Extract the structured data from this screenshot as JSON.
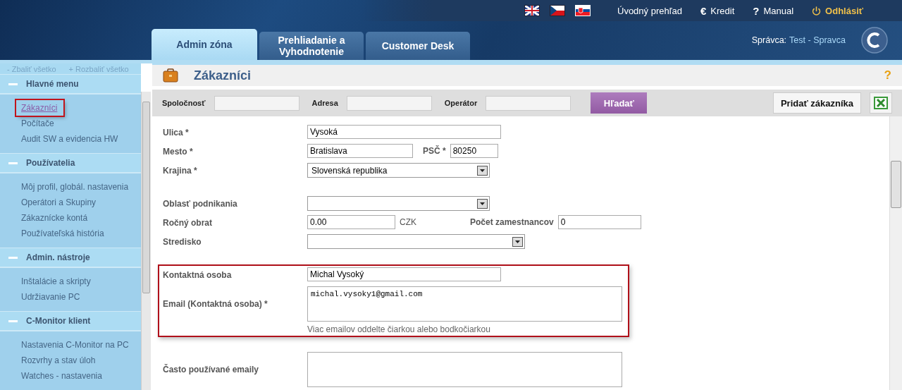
{
  "header": {
    "languages": [
      {
        "kind": "uk",
        "selected": false
      },
      {
        "kind": "cz",
        "selected": false
      },
      {
        "kind": "sk",
        "selected": true
      }
    ],
    "links": [
      {
        "kind": "plain",
        "label": "Úvodný prehľad"
      },
      {
        "kind": "char",
        "icon": "€",
        "label": "Kredit"
      },
      {
        "kind": "char",
        "icon": "?",
        "label": "Manual"
      },
      {
        "kind": "logout",
        "label": "Odhlásiť"
      }
    ],
    "tabs": [
      {
        "label": "Admin zóna",
        "selected": true
      },
      {
        "label": "Prehliadanie a Vyhodnotenie",
        "selected": false
      },
      {
        "label": "Customer Desk",
        "selected": false
      }
    ],
    "user_label": "Správca:",
    "user_name": "Test - Spravca"
  },
  "sidebar": {
    "collapse_all": "- Zbaliť všetko",
    "expand_all": "+ Rozbaliť všetko",
    "groups": [
      {
        "title": "Hlavné menu",
        "expanded": true,
        "items": [
          {
            "label": "Zákazníci",
            "selected": true
          },
          {
            "label": "Počítače",
            "selected": false
          },
          {
            "label": "Audit SW a evidencia HW",
            "selected": false
          }
        ]
      },
      {
        "title": "Používatelia",
        "expanded": true,
        "items": [
          {
            "label": "Môj profil, globál. nastavenia",
            "selected": false
          },
          {
            "label": "Operátori a Skupiny",
            "selected": false
          },
          {
            "label": "Zákaznícke kontá",
            "selected": false
          },
          {
            "label": "Používateľská história",
            "selected": false
          }
        ]
      },
      {
        "title": "Admin. nástroje",
        "expanded": true,
        "items": [
          {
            "label": "Inštalácie a skripty",
            "selected": false
          },
          {
            "label": "Udržiavanie PC",
            "selected": false
          }
        ]
      },
      {
        "title": "C-Monitor klient",
        "expanded": true,
        "items": [
          {
            "label": "Nastavenia C-Monitor na PC",
            "selected": false
          },
          {
            "label": "Rozvrhy a stav úloh",
            "selected": false
          },
          {
            "label": "Watches - nastavenia",
            "selected": false
          }
        ]
      }
    ]
  },
  "page": {
    "title": "Zákazníci",
    "help": "?",
    "filters": [
      {
        "label": "Spoločnosť"
      },
      {
        "label": "Adresa"
      },
      {
        "label": "Operátor"
      }
    ],
    "search_button": "Hľadať",
    "add_button": "Pridať zákazníka",
    "sections": [
      {
        "highlighted": false,
        "rows": [
          {
            "kind": "text",
            "label": "Ulica *",
            "value": "Vysoká"
          },
          {
            "kind": "text",
            "label": "Mesto *",
            "value": "Bratislava",
            "extra": {
              "label": "PSČ *",
              "value": "80250"
            }
          },
          {
            "kind": "select",
            "label": "Krajina *",
            "value": "Slovenská republika"
          }
        ]
      },
      {
        "highlighted": false,
        "rows": [
          {
            "kind": "select",
            "label": "Oblasť podnikania"
          },
          {
            "kind": "text",
            "label": "Ročný obrat",
            "value": "0.00",
            "suffix": "CZK",
            "extra": {
              "label": "Počet zamestnancov",
              "value": "0"
            }
          },
          {
            "kind": "select",
            "label": "Stredisko"
          }
        ]
      },
      {
        "highlighted": true,
        "rows": [
          {
            "kind": "text",
            "label": "Kontaktná osoba",
            "value": "Michal Vysoký"
          },
          {
            "kind": "textarea",
            "label": "Email (Kontaktná osoba) *",
            "value": "michal.vysoky1@gmail.com",
            "hint": "Viac emailov oddelte čiarkou alebo bodkočiarkou"
          }
        ]
      },
      {
        "highlighted": false,
        "rows": [
          {
            "kind": "textarea",
            "label": "Často používané emaily"
          }
        ]
      }
    ]
  }
}
